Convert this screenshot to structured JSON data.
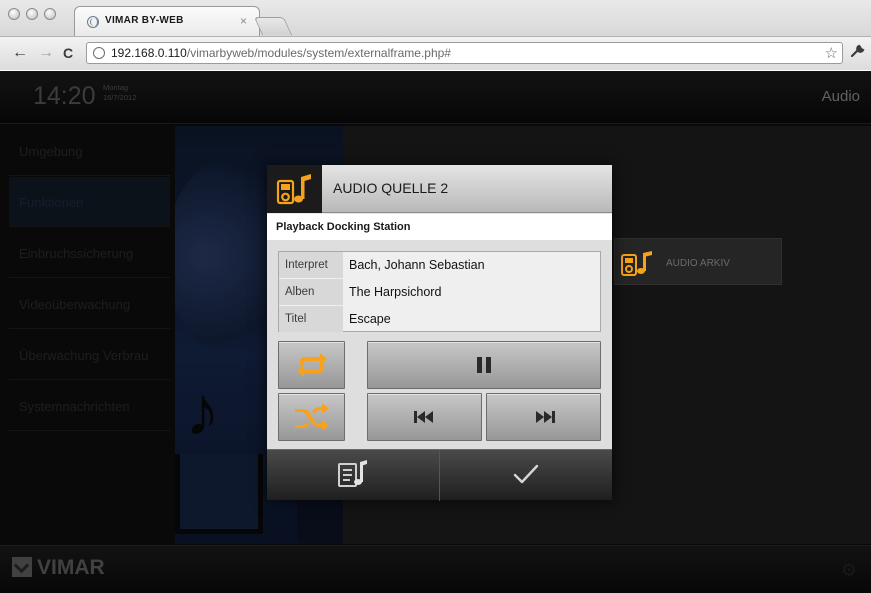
{
  "browser": {
    "tab_title": "VIMAR BY-WEB",
    "tab_close": "×",
    "url_host": "192.168.0.110",
    "url_path": "/vimarbyweb/modules/system/externalframe.php#",
    "back": "←",
    "forward": "→",
    "reload": "C",
    "star": "☆",
    "wrench": "🔧"
  },
  "header": {
    "time": "14:20",
    "day": "Montag",
    "date": "16/7/2012",
    "section": "Audio"
  },
  "sidebar": {
    "items": [
      {
        "label": "Umgebung",
        "active": false
      },
      {
        "label": "Funktionen",
        "active": true
      },
      {
        "label": "Einbruchssicherung",
        "active": false
      },
      {
        "label": "Videoüberwachung",
        "active": false
      },
      {
        "label": "Überwachung Verbrau",
        "active": false
      },
      {
        "label": "Systemnachrichten",
        "active": false
      }
    ]
  },
  "content": {
    "archive_label": "AUDIO ARKIV"
  },
  "footer": {
    "brand": "VIMAR"
  },
  "dialog": {
    "title": "AUDIO QUELLE 2",
    "subtitle": "Playback Docking Station",
    "info": [
      {
        "key": "Interpret",
        "value": "Bach, Johann Sebastian"
      },
      {
        "key": "Alben",
        "value": "The Harpsichord"
      },
      {
        "key": "Titel",
        "value": "Escape"
      }
    ],
    "controls": [
      "repeat-icon",
      "pause-icon",
      "shuffle-icon",
      "previous-icon",
      "next-icon"
    ],
    "footer_buttons": [
      "playlist-icon",
      "checkmark-icon"
    ]
  },
  "colors": {
    "accent_orange": "#f7a21b",
    "app_background": "#0e0e0e",
    "dialog_background": "#e8e8e8"
  }
}
